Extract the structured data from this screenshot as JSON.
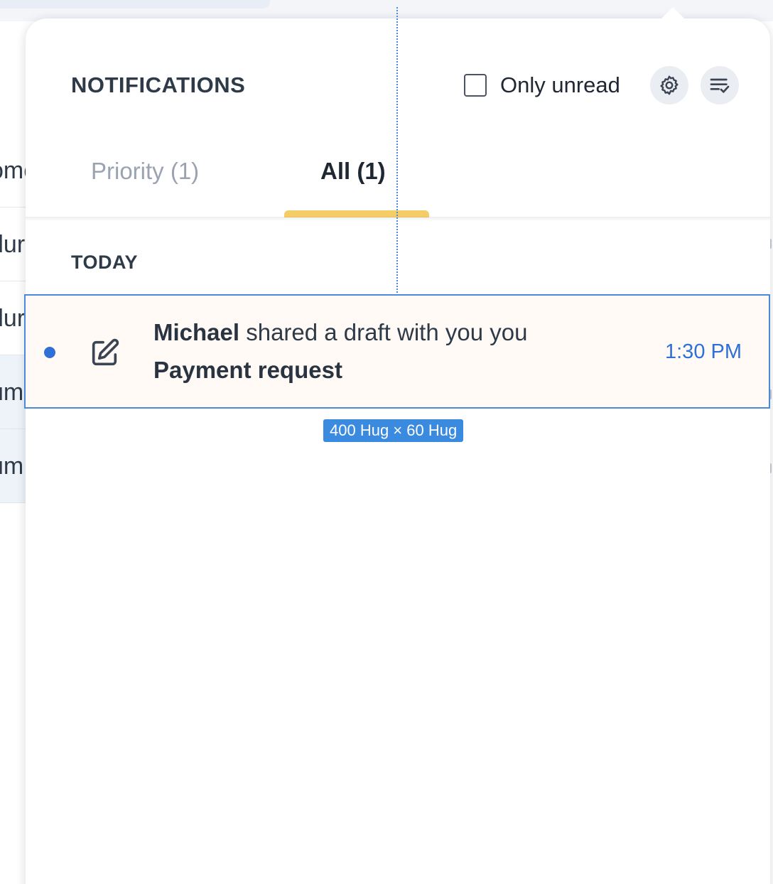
{
  "background": {
    "row_fragments": [
      "omc",
      "dur",
      "dur",
      "um",
      "um"
    ]
  },
  "panel": {
    "title": "NOTIFICATIONS",
    "only_unread_label": "Only unread",
    "only_unread_checked": false,
    "settings_icon": "gear-icon",
    "mark_all_icon": "list-check-icon"
  },
  "tabs": [
    {
      "label": "Priority (1)",
      "active": false
    },
    {
      "label": "All (1)",
      "active": true
    }
  ],
  "sections": [
    {
      "heading": "TODAY",
      "items": [
        {
          "unread": true,
          "icon": "edit-icon",
          "actor": "Michael",
          "action": " shared a draft with you you",
          "subject": "Payment request",
          "time": "1:30 PM"
        }
      ]
    }
  ],
  "overlay": {
    "size_badge": "400 Hug × 60 Hug"
  },
  "colors": {
    "accent_blue": "#2f6fd6",
    "tab_indicator": "#f5cd66",
    "selection": "#4a8ad8",
    "row_background": "#fffaf5"
  }
}
